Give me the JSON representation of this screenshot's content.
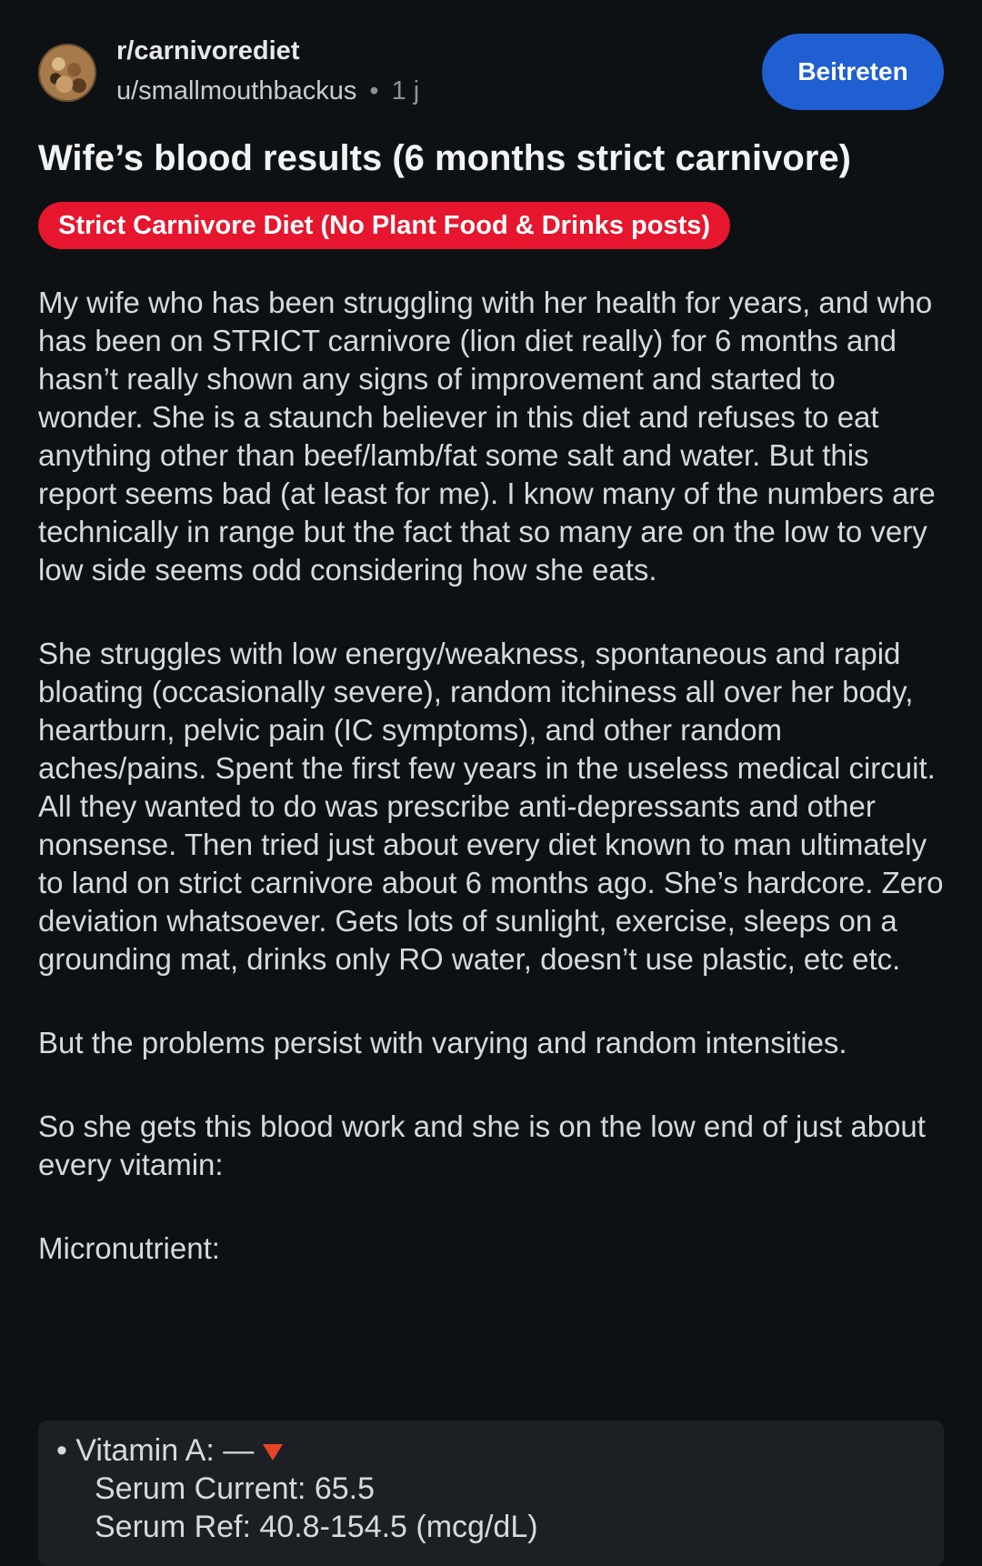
{
  "header": {
    "subreddit": "r/carnivorediet",
    "username": "u/smallmouthbackus",
    "separator": "•",
    "age": "1 j",
    "join_label": "Beitreten"
  },
  "post": {
    "title": "Wife’s blood results (6 months strict carnivore)",
    "flair": "Strict Carnivore Diet (No Plant Food & Drinks posts)",
    "paragraphs": [
      "My wife who has been struggling with her health for years, and who has been on STRICT carnivore (lion diet really) for 6 months and hasn’t really shown any signs of improvement and started to wonder. She is a staunch believer in this diet and refuses to eat anything other than beef/lamb/fat some salt and water. But this report seems bad (at least for me). I know many of the numbers are technically in range but the fact that so many are on the low to very low side seems odd considering how she eats.",
      "She struggles with low energy/weakness, spontaneous and rapid bloating (occasionally severe), random itchiness all over her body, heartburn, pelvic pain (IC symptoms), and other random aches/pains. Spent the first few years in the useless medical circuit. All they wanted to do was prescribe anti-depressants and other nonsense. Then tried just about every diet known to man ultimately to land on strict carnivore about 6 months ago. She’s hardcore. Zero deviation whatsoever. Gets lots of sunlight, exercise, sleeps on a grounding mat, drinks only RO water, doesn’t use plastic, etc etc.",
      "But the problems persist with varying and random intensities.",
      "So she gets this blood work and she is on the low end of just about every vitamin:",
      "Micronutrient:"
    ],
    "code_lines": [
      "• Vitamin A: —",
      "Serum Current: 65.5",
      "Serum Ref: 40.8-154.5 (mcg/dL)"
    ]
  },
  "icons": {
    "down_indicator": "red-down-triangle-icon",
    "indicator_color": "#e8432a"
  },
  "colors": {
    "background": "#0e1113",
    "join_button": "#1f5fd1",
    "flair": "#e5162d",
    "code_block": "#1c2024"
  }
}
